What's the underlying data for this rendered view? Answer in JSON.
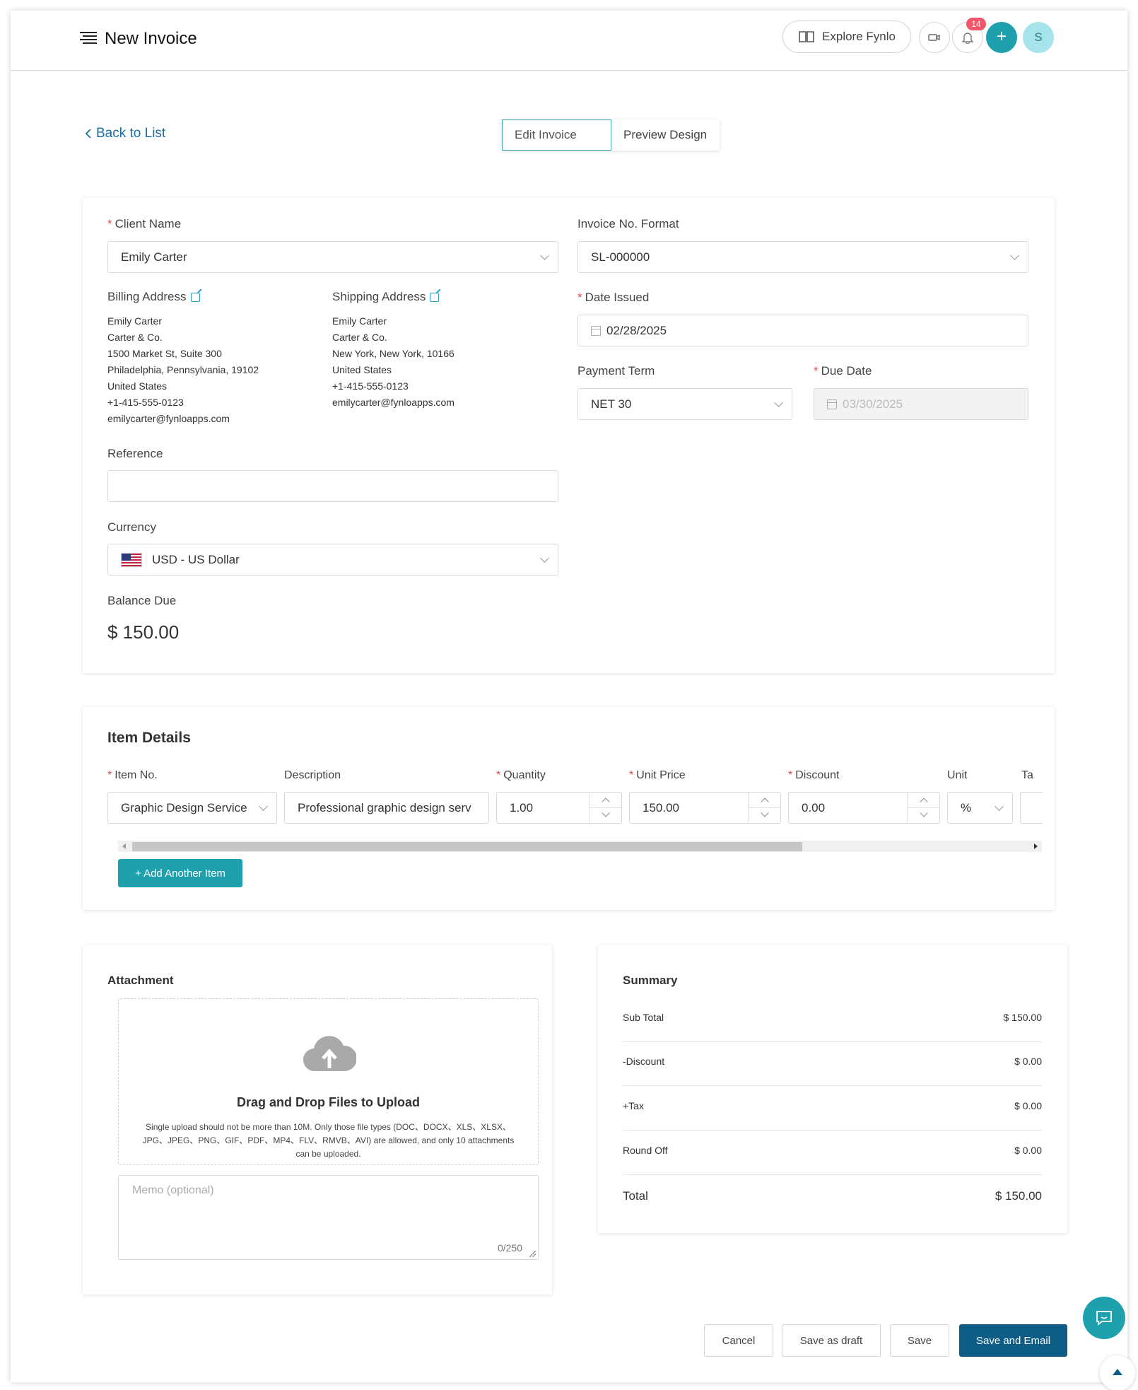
{
  "header": {
    "title": "New Invoice",
    "explore_label": "Explore Fynlo",
    "notification_count": "14",
    "add_symbol": "+",
    "avatar_initial": "S"
  },
  "nav": {
    "back_label": "Back to List",
    "tabs": [
      {
        "label": "Edit Invoice",
        "active": true
      },
      {
        "label": "Preview Design",
        "active": false
      }
    ]
  },
  "invoice": {
    "client_name_label": "Client Name",
    "client_name_value": "Emily Carter",
    "invoice_no_format_label": "Invoice No. Format",
    "invoice_no_format_value": "SL-000000",
    "billing_address_label": "Billing Address",
    "billing_address": [
      "Emily Carter",
      "Carter & Co.",
      "1500 Market St, Suite 300",
      "Philadelphia, Pennsylvania, 19102",
      "United States",
      "+1-415-555-0123",
      "emilycarter@fynloapps.com"
    ],
    "shipping_address_label": "Shipping Address",
    "shipping_address": [
      "Emily Carter",
      "Carter & Co.",
      "New York, New York, 10166",
      "United States",
      "+1-415-555-0123",
      "emilycarter@fynloapps.com"
    ],
    "date_issued_label": "Date Issued",
    "date_issued_value": "02/28/2025",
    "payment_term_label": "Payment Term",
    "payment_term_value": "NET 30",
    "due_date_label": "Due Date",
    "due_date_value": "03/30/2025",
    "reference_label": "Reference",
    "reference_value": "",
    "currency_label": "Currency",
    "currency_value": "USD - US Dollar",
    "balance_due_label": "Balance Due",
    "balance_due_value": "$ 150.00"
  },
  "items": {
    "title": "Item Details",
    "columns": {
      "item_no": "Item No.",
      "description": "Description",
      "quantity": "Quantity",
      "unit_price": "Unit Price",
      "discount": "Discount",
      "unit": "Unit",
      "tax": "Ta"
    },
    "row": {
      "item_no": "Graphic Design Service",
      "description": "Professional graphic design serv",
      "quantity": "1.00",
      "unit_price": "150.00",
      "discount": "0.00",
      "unit": "%"
    },
    "add_label": "+ Add Another Item"
  },
  "attachment": {
    "title": "Attachment",
    "drop_title": "Drag and Drop Files to Upload",
    "drop_note": "Single upload should not be more than 10M. Only those file types (DOC、DOCX、XLS、XLSX、JPG、JPEG、PNG、GIF、PDF、MP4、FLV、RMVB、AVI) are allowed, and only 10 attachments can be uploaded.",
    "memo_placeholder": "Memo (optional)",
    "memo_count": "0/250"
  },
  "summary": {
    "title": "Summary",
    "rows": [
      {
        "label": "Sub Total",
        "value": "$ 150.00"
      },
      {
        "label": "-Discount",
        "value": "$ 0.00"
      },
      {
        "label": "+Tax",
        "value": "$ 0.00"
      },
      {
        "label": "Round Off",
        "value": "$ 0.00"
      }
    ],
    "total_label": "Total",
    "total_value": "$ 150.00"
  },
  "actions": {
    "cancel": "Cancel",
    "save_draft": "Save as draft",
    "save": "Save",
    "save_email": "Save and Email"
  },
  "colors": {
    "accent": "#1fa0ad",
    "primary": "#0d5d86",
    "required": "#e34d4d",
    "link": "#1a6fa0"
  }
}
